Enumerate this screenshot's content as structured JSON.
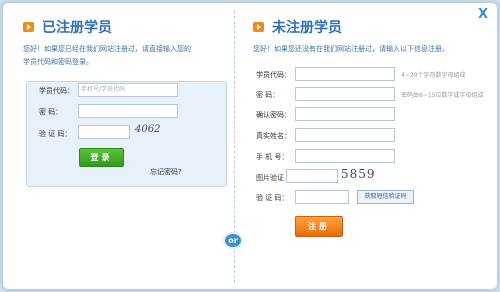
{
  "close_label": "X",
  "or_label": "or",
  "left": {
    "title": "已注册学员",
    "desc_line1": "您好！如果您已经在我们网站注册过，请直接输入您的",
    "desc_line2": "学员代码和密码登录。",
    "fields": {
      "code_label": "学员代码：",
      "code_placeholder": "手机号/学员代码",
      "password_label": "密   码：",
      "captcha_label": "验 证 码：",
      "captcha_text": "4062"
    },
    "login_button": "登录",
    "forgot": "忘记密码?"
  },
  "right": {
    "title": "未注册学员",
    "desc": "您好！如果您还没有在我们网站注册过，请输入以下信息注册。",
    "fields": {
      "code_label": "学员代码：",
      "code_hint": "4~20个字符数字母组成",
      "password_label": "密   码：",
      "password_hint": "密码由6~15位数字或字母组成",
      "confirm_label": "确认密码：",
      "realname_label": "真实姓名：",
      "phone_label": "手 机 号：",
      "image_captcha_label": "图片验证",
      "image_captcha_text": "5859",
      "sms_captcha_label": "验 证 码：",
      "sms_button": "获取短信验证码"
    },
    "register_button": "注册"
  },
  "colors": {
    "accent_blue": "#2f6fba",
    "green_button": "#3fa824",
    "orange_button": "#f07d16",
    "title_icon": "#f08a1c"
  }
}
